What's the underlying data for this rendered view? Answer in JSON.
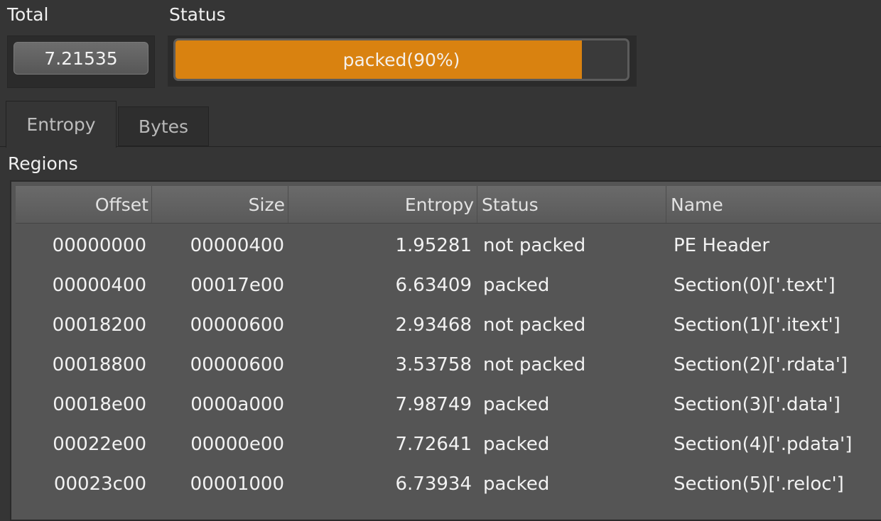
{
  "header": {
    "total_label": "Total",
    "status_label": "Status",
    "total_value": "7.21535",
    "status_text": "packed(90%)",
    "status_progress_fraction": 0.9,
    "status_color": "#d98210"
  },
  "tabs": [
    {
      "label": "Entropy",
      "active": true
    },
    {
      "label": "Bytes",
      "active": false
    }
  ],
  "regions": {
    "label": "Regions",
    "columns": [
      "Offset",
      "Size",
      "Entropy",
      "Status",
      "Name"
    ],
    "rows": [
      {
        "offset": "00000000",
        "size": "00000400",
        "entropy": "1.95281",
        "status": "not packed",
        "name": "PE Header"
      },
      {
        "offset": "00000400",
        "size": "00017e00",
        "entropy": "6.63409",
        "status": "packed",
        "name": "Section(0)['.text']"
      },
      {
        "offset": "00018200",
        "size": "00000600",
        "entropy": "2.93468",
        "status": "not packed",
        "name": "Section(1)['.itext']"
      },
      {
        "offset": "00018800",
        "size": "00000600",
        "entropy": "3.53758",
        "status": "not packed",
        "name": "Section(2)['.rdata']"
      },
      {
        "offset": "00018e00",
        "size": "0000a000",
        "entropy": "7.98749",
        "status": "packed",
        "name": "Section(3)['.data']"
      },
      {
        "offset": "00022e00",
        "size": "00000e00",
        "entropy": "7.72641",
        "status": "packed",
        "name": "Section(4)['.pdata']"
      },
      {
        "offset": "00023c00",
        "size": "00001000",
        "entropy": "6.73934",
        "status": "packed",
        "name": "Section(5)['.reloc']"
      }
    ]
  }
}
